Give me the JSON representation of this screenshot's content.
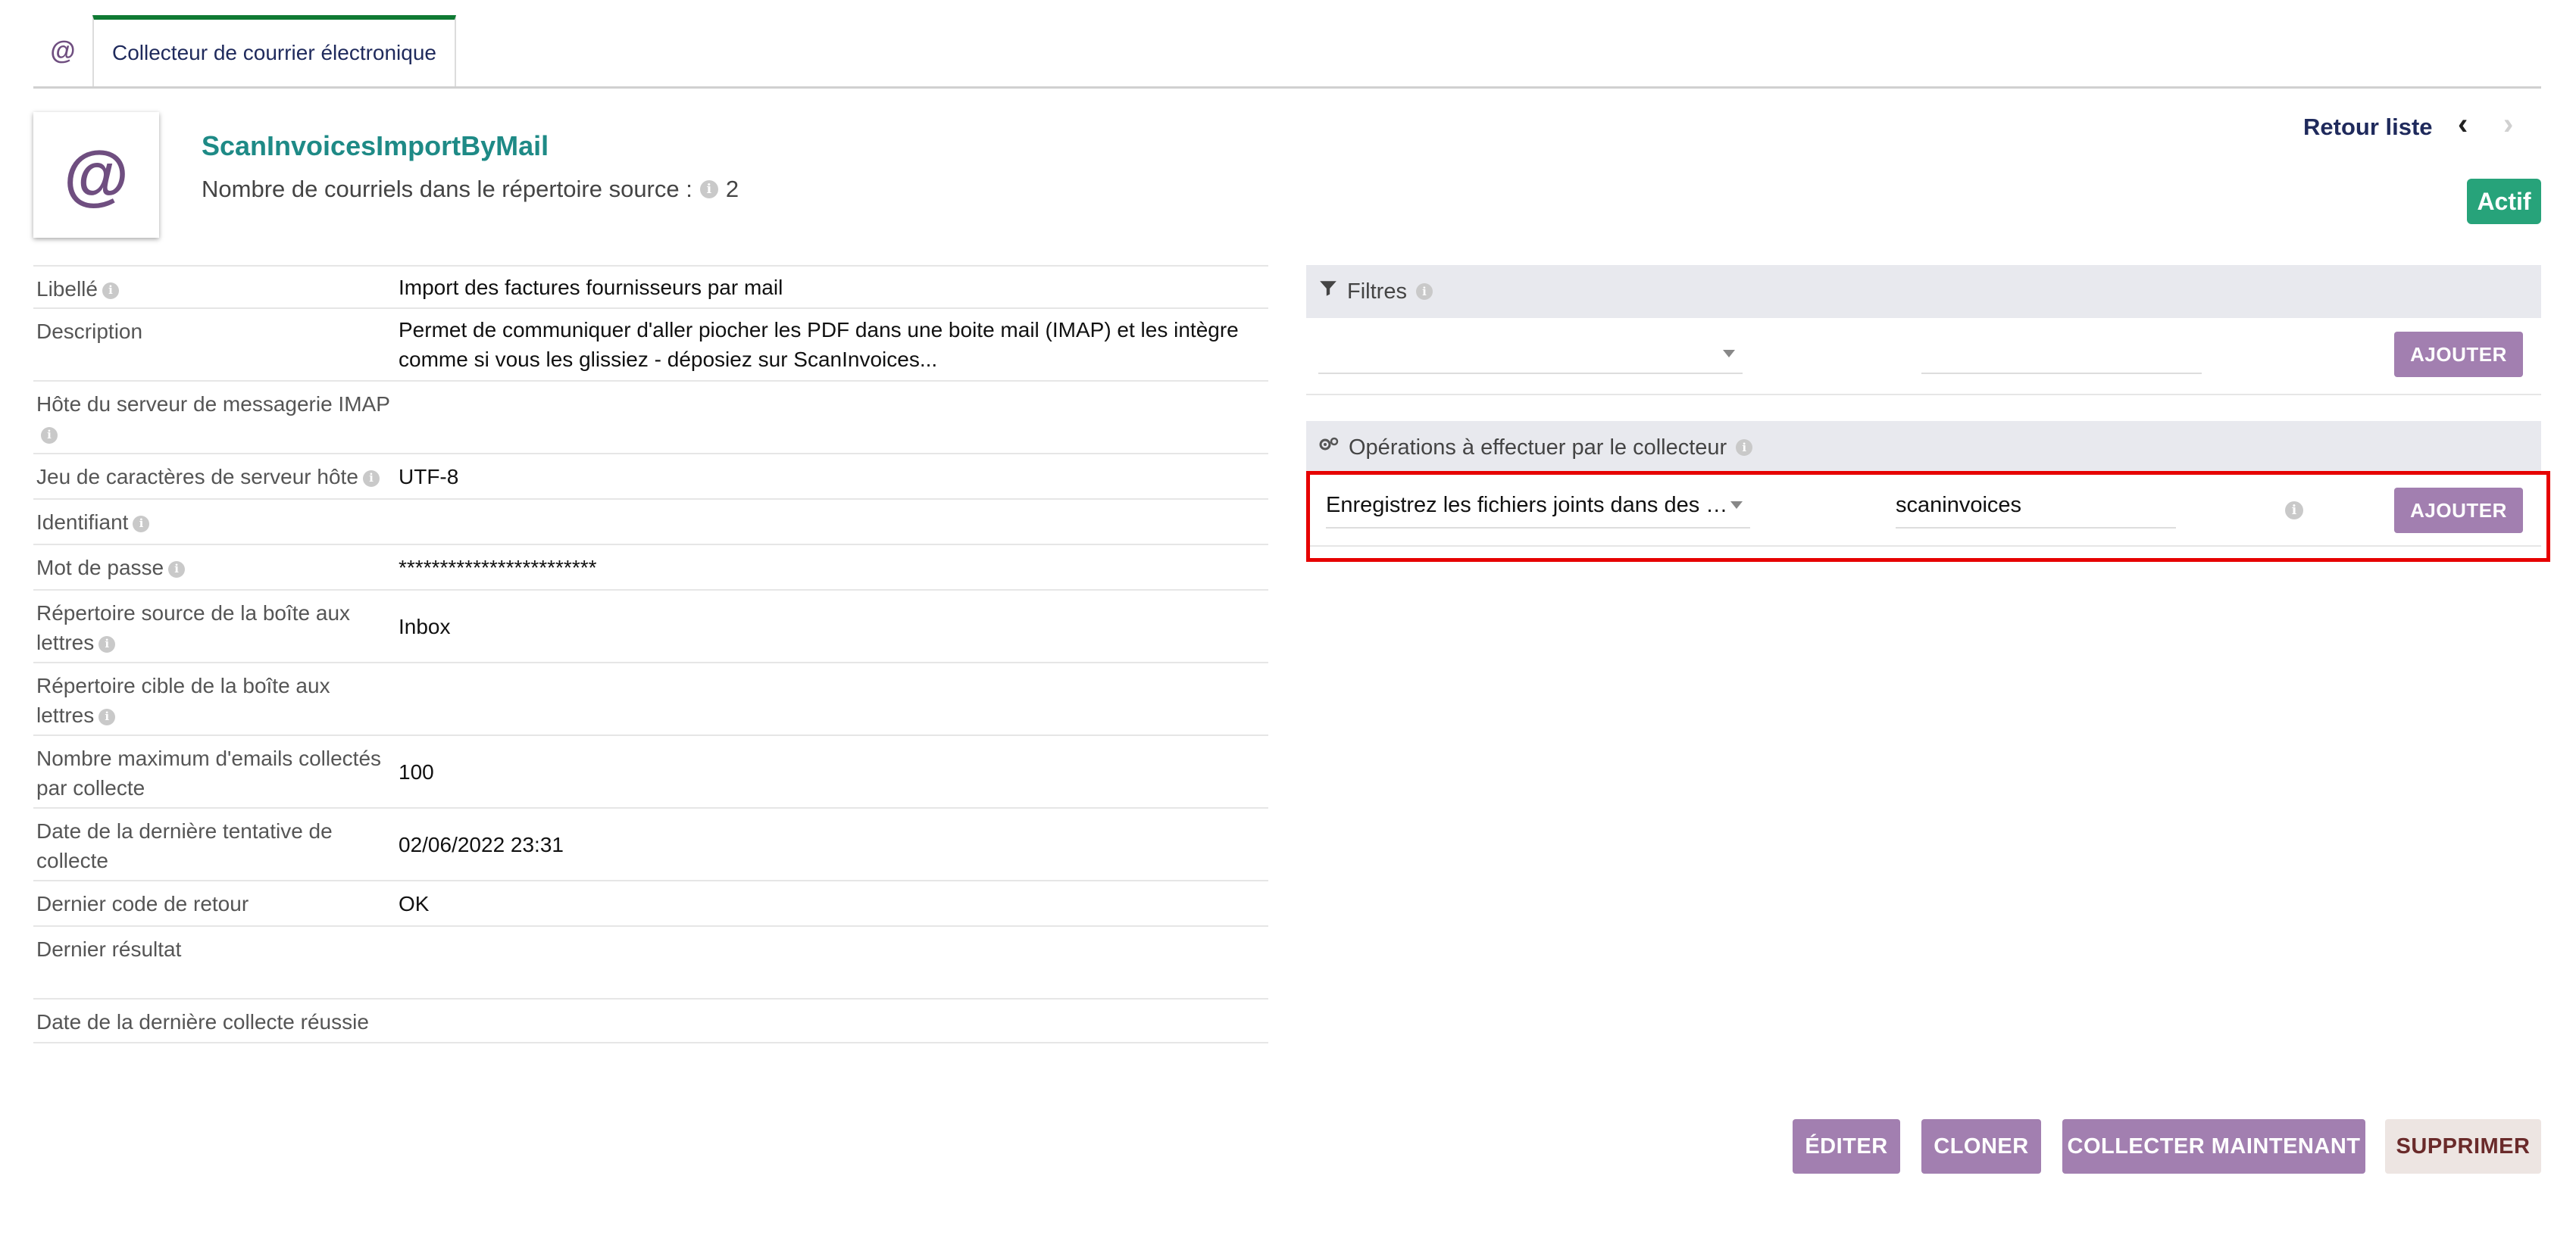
{
  "tabs": {
    "icon_label": "@",
    "active_label": "Collecteur de courrier électronique"
  },
  "header": {
    "logo_label": "@",
    "ref": "ScanInvoicesImportByMail",
    "count_label": "Nombre de courriels dans le répertoire source :",
    "count_value": "2",
    "back_list": "Retour liste",
    "status": "Actif"
  },
  "fields": [
    {
      "label": "Libellé",
      "info": true,
      "value": "Import des factures fournisseurs par mail"
    },
    {
      "label": "Description",
      "info": false,
      "value": "Permet de communiquer d'aller piocher les PDF dans une boite mail (IMAP) et les intègre comme si vous les glissiez - déposiez sur ScanInvoices..."
    },
    {
      "label": "Hôte du serveur de messagerie IMAP",
      "info": true,
      "value": ""
    },
    {
      "label": "Jeu de caractères de serveur hôte",
      "info": true,
      "value": "UTF-8"
    },
    {
      "label": "Identifiant",
      "info": true,
      "value": ""
    },
    {
      "label": "Mot de passe",
      "info": true,
      "value": "************************"
    },
    {
      "label": "Répertoire source de la boîte aux lettres",
      "info": true,
      "value": "Inbox"
    },
    {
      "label": "Répertoire cible de la boîte aux lettres",
      "info": true,
      "value": ""
    },
    {
      "label": "Nombre maximum d'emails collectés par collecte",
      "info": false,
      "value": "100"
    },
    {
      "label": "Date de la dernière tentative de collecte",
      "info": false,
      "value": "02/06/2022 23:31"
    },
    {
      "label": "Dernier code de retour",
      "info": false,
      "value": "OK"
    },
    {
      "label": "Dernier résultat",
      "info": false,
      "value": ""
    },
    {
      "label": "Date de la dernière collecte réussie",
      "info": false,
      "value": ""
    }
  ],
  "filters": {
    "title": "Filtres",
    "select_value": "",
    "text_value": "",
    "add_label": "AJOUTER"
  },
  "operations": {
    "title": "Opérations à effectuer par le collecteur",
    "select_value": "Enregistrez les fichiers joints dans des …",
    "text_value": "scaninvoices",
    "add_label": "AJOUTER"
  },
  "actions": {
    "edit": "ÉDITER",
    "clone": "CLONER",
    "collect_now": "COLLECTER MAINTENANT",
    "delete": "SUPPRIMER"
  },
  "colors": {
    "accent": "#a27fb0",
    "active_tab": "#0f7a33",
    "status": "#27a37a",
    "highlight": "#e60000",
    "ref": "#1e8a86"
  }
}
